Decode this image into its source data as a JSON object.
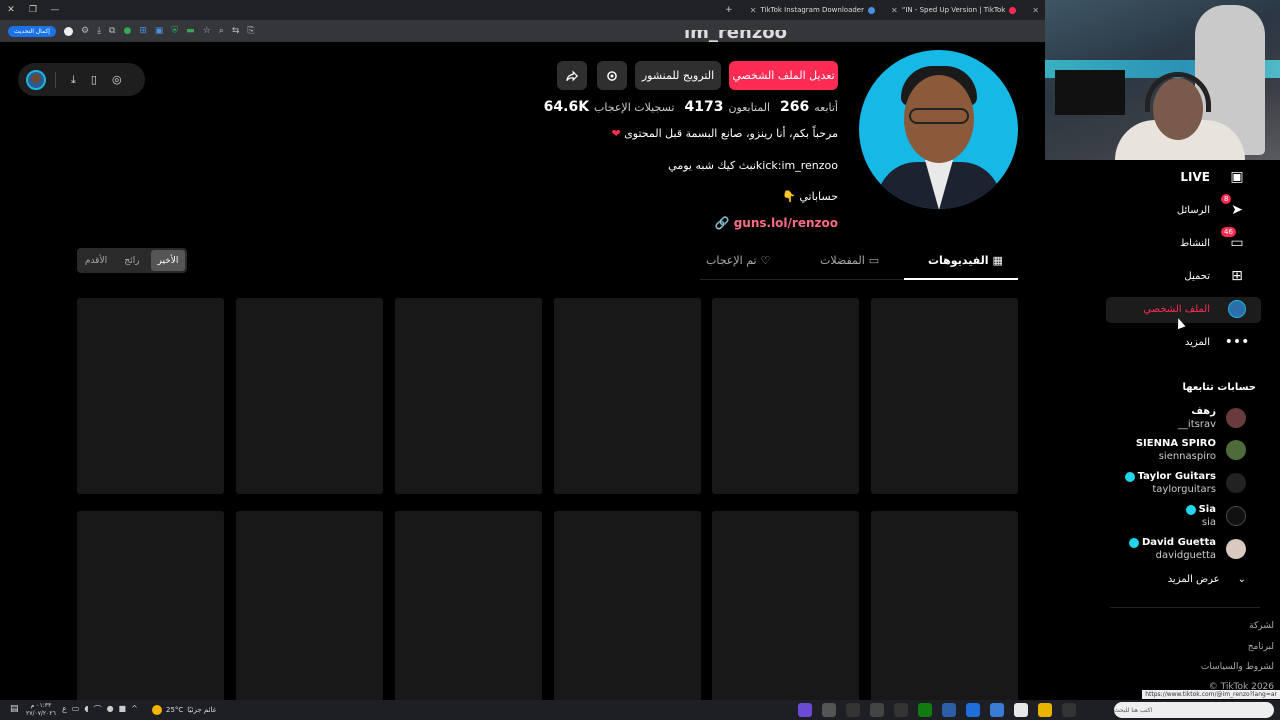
{
  "browser": {
    "tabs": [
      {
        "title": "TikTok Instagram Downloader"
      },
      {
        "title": "“IN - Sped Up Version | TikTok"
      }
    ],
    "update_label": "إكمال التحديث"
  },
  "profile": {
    "username_partial": "im_renzoo",
    "buttons": {
      "edit": "تعديل الملف الشخصي",
      "promote": "الترويج للمنشور"
    },
    "stats": [
      {
        "value": "266",
        "label": "أتابعه"
      },
      {
        "value": "4173",
        "label": "المتابعون"
      },
      {
        "value": "64.6K",
        "label": "تسجيلات الإعجاب"
      }
    ],
    "bio_lines": [
      "مرحباً بكم، أنا رينزو، صانع البسمة قبل المحتوى",
      "kick:im_renzooنبث كيك شبه يومي",
      "حساباتي 👇"
    ],
    "link": "guns.lol/renzoo"
  },
  "content_tabs": [
    {
      "label": "الفيديوهات",
      "icon": "grid-icon"
    },
    {
      "label": "المفضلات",
      "icon": "bookmark-icon"
    },
    {
      "label": "تم الإعجاب",
      "icon": "heart-icon"
    }
  ],
  "sort_options": [
    {
      "label": "الأخير",
      "active": true
    },
    {
      "label": "رائج",
      "active": false
    },
    {
      "label": "الأقدم",
      "active": false
    }
  ],
  "sidebar": {
    "nav": [
      {
        "label": "LIVE",
        "icon": "live-icon"
      },
      {
        "label": "الرسائل",
        "icon": "send-icon",
        "badge": "8"
      },
      {
        "label": "النشاط",
        "icon": "activity-icon",
        "badge": "46"
      },
      {
        "label": "تحميل",
        "icon": "upload-icon"
      },
      {
        "label": "الملف الشخصي",
        "icon": "profile-avatar",
        "active": true
      },
      {
        "label": "المزيد",
        "icon": "more-icon"
      }
    ],
    "following_title": "حسابات تتابعها",
    "following": [
      {
        "name": "زهف",
        "user": "__itsrav",
        "verified": false
      },
      {
        "name": "SIENNA SPIRO",
        "user": "siennaspiro",
        "verified": false
      },
      {
        "name": "Taylor Guitars",
        "user": "taylorguitars",
        "verified": true
      },
      {
        "name": "Sia",
        "user": "sia",
        "verified": true
      },
      {
        "name": "David Guetta",
        "user": "davidguetta",
        "verified": true
      }
    ],
    "see_more": "عرض المزيد",
    "footer": [
      "لشركة",
      "لبرنامج",
      "لشروط والسياسات",
      "TikTok 2026 ©"
    ],
    "status_url": "https://www.tiktok.com/@im_renzo?lang=ar"
  },
  "taskbar": {
    "time": "٠١:٣٣ م",
    "date": "٢٧/٠٧/٢٠٢٦",
    "temperature": "25°C",
    "weather_label": "غائم جزئيًا",
    "search_placeholder": "اكتب هنا للبحث"
  },
  "colors": {
    "accent": "#fe2c55",
    "background": "#000000",
    "avatar_bg": "#16b9e6"
  }
}
